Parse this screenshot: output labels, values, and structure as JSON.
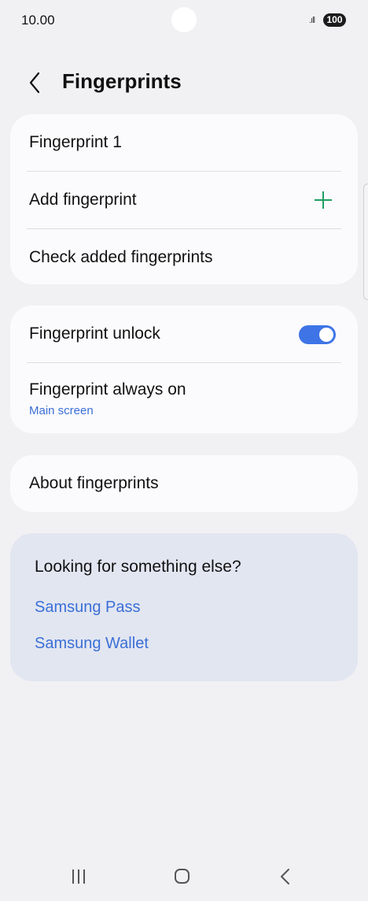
{
  "status_bar": {
    "time": "10.00",
    "signal": ".ıll",
    "battery": "100"
  },
  "header": {
    "title": "Fingerprints",
    "back_icon": "chevron-left-icon"
  },
  "fingerprint_card": {
    "items": [
      {
        "label": "Fingerprint 1"
      },
      {
        "label": "Add fingerprint",
        "icon": "plus-icon",
        "icon_color": "#1f9e63"
      },
      {
        "label": "Check added fingerprints"
      }
    ]
  },
  "settings_card": {
    "unlock": {
      "label": "Fingerprint unlock",
      "toggle_on": true,
      "toggle_color": "#3e74e6"
    },
    "always_on": {
      "label": "Fingerprint always on",
      "value": "Main screen"
    }
  },
  "about_card": {
    "label": "About fingerprints"
  },
  "suggestions": {
    "title": "Looking for something else?",
    "links": [
      "Samsung Pass",
      "Samsung Wallet"
    ],
    "link_color": "#3b6fd6"
  },
  "nav_bar": {
    "recents_icon": "recents-icon",
    "home_icon": "home-icon",
    "back_icon": "back-icon"
  }
}
